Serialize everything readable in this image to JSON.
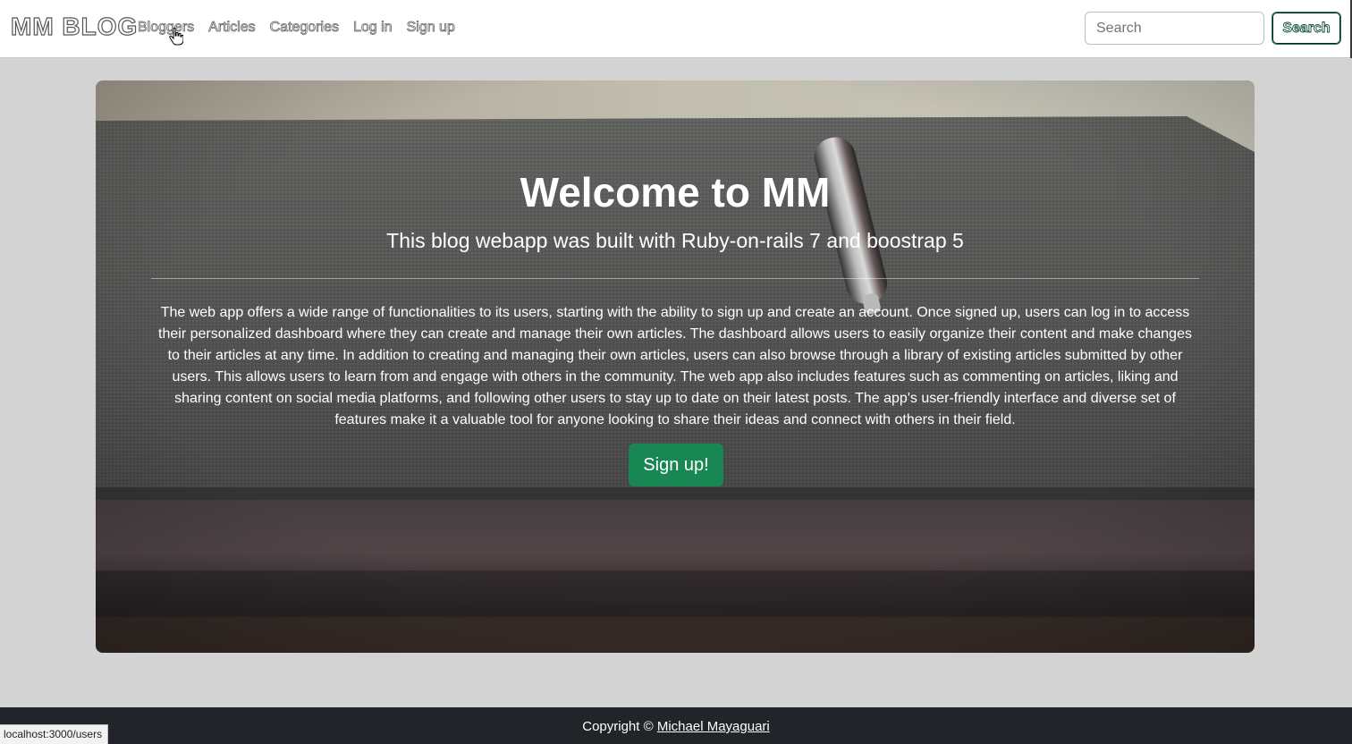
{
  "navbar": {
    "brand": "MM BLOG",
    "links": [
      {
        "label": "Bloggers"
      },
      {
        "label": "Articles"
      },
      {
        "label": "Categories"
      },
      {
        "label": "Log in"
      },
      {
        "label": "Sign up"
      }
    ],
    "search": {
      "placeholder": "Search",
      "value": ""
    },
    "search_button": "Search"
  },
  "hero": {
    "title": "Welcome to MM",
    "subtitle": "This blog webapp was built with Ruby-on-rails 7 and boostrap 5",
    "description": "The web app offers a wide range of functionalities to its users, starting with the ability to sign up and create an account. Once signed up, users can log in to access their personalized dashboard where they can create and manage their own articles. The dashboard allows users to easily organize their content and make changes to their articles at any time. In addition to creating and managing their own articles, users can also browse through a library of existing articles submitted by other users. This allows users to learn from and engage with others in the community. The web app also includes features such as commenting on articles, liking and sharing content on social media platforms, and following other users to stay up to date on their latest posts. The app's user-friendly interface and diverse set of features make it a valuable tool for anyone looking to share their ideas and connect with others in their field.",
    "cta": "Sign up!"
  },
  "footer": {
    "copyright": "Copyright ©",
    "author": "Michael Mayaguari"
  },
  "status_bar": {
    "url": "localhost:3000/users"
  },
  "colors": {
    "accent": "#198754",
    "footer_bg": "#212529",
    "page_bg": "#d3d3d3"
  }
}
